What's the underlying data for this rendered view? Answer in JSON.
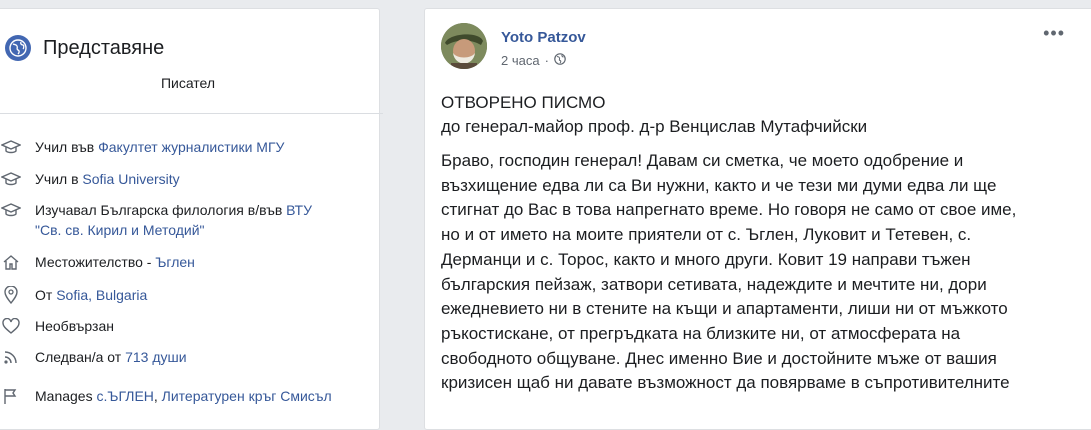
{
  "intro": {
    "title": "Представяне",
    "bio": "Писател",
    "education1": {
      "prefix": "Учил във ",
      "link": "Факултет журналистики МГУ"
    },
    "education2": {
      "prefix": "Учил в ",
      "link": "Sofia University"
    },
    "education3": {
      "prefix": "Изучавал Българска филология в/във ",
      "link": "ВТУ",
      "link2": "\"Св. св. Кирил и Методий\""
    },
    "residence": {
      "prefix": "Местожителство - ",
      "link": "Ъглен"
    },
    "from": {
      "prefix": "От ",
      "link": "Sofia, Bulgaria"
    },
    "relationship": "Необвързан",
    "followers": {
      "prefix": "Следван/а от ",
      "link": "713 души"
    },
    "manages": {
      "prefix": "Manages ",
      "link": "с.ЪГЛЕН",
      "sep": ", ",
      "link2": "Литературен кръг Смисъл"
    }
  },
  "post": {
    "author": "Yoto Patzov",
    "time": "2 часа",
    "heading": "ОТВОРЕНО ПИСМО",
    "subheading": "до генерал-майор проф. д-р Венцислав Мутафчийски",
    "lines": [
      "Браво, господин генерал! Давам си сметка, че моето одобрение и",
      "възхищение едва ли са Ви нужни, както и че тези ми думи едва ли ще",
      "стигнат до Вас в това напрегнато време. Но говоря не само от свое име,",
      "но и от името на моите приятели от с. Ъглен, Луковит и Тетевен, с.",
      "Дерманци и с. Торос, както и много други. Ковит 19 направи тъжен",
      "българския пейзаж, затвори сетивата, надеждите и мечтите ни, дори",
      "ежедневието ни в стените на къщи и апартаменти, лиши ни от мъжкото",
      "ръкостискане, от прегръдката на близките ни, от атмосферата на",
      "свободното общуване. Днес именно Вие и достойните мъже от вашия",
      "кризисен щаб ни давате възможност да повярваме в съпротивителните"
    ]
  },
  "colors": {
    "link": "#365899",
    "text": "#1c1e21",
    "meta": "#606770",
    "bg": "#e9ebee"
  }
}
